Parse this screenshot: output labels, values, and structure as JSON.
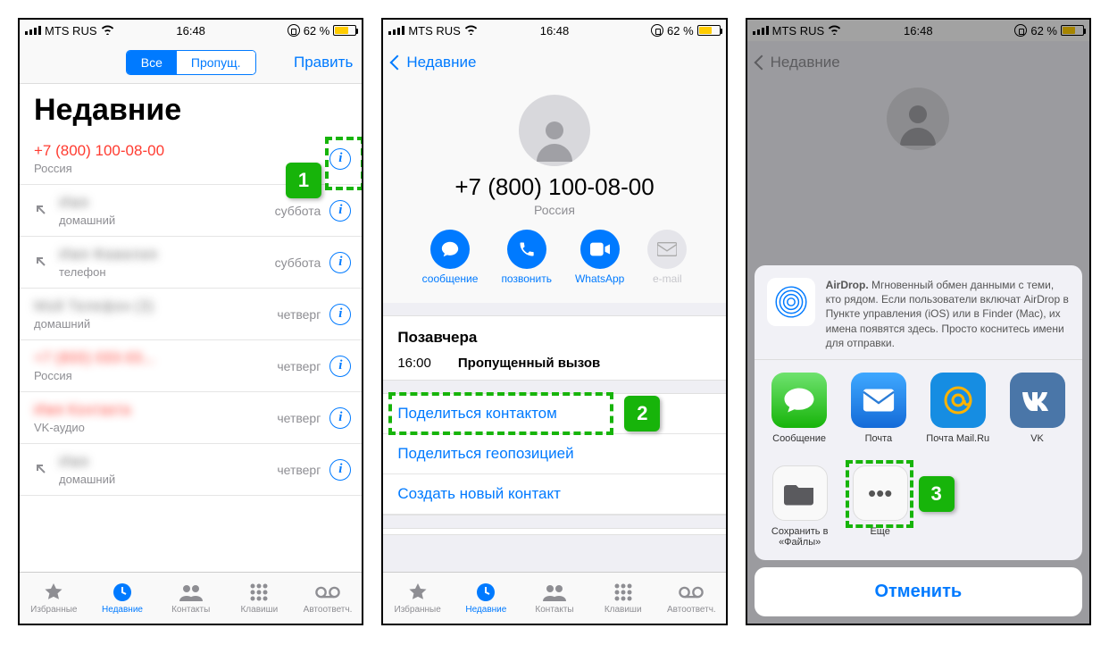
{
  "status": {
    "carrier": "MTS RUS",
    "time": "16:48",
    "battery": "62 %"
  },
  "screen1": {
    "seg_all": "Все",
    "seg_missed": "Пропущ.",
    "edit": "Править",
    "title": "Недавние",
    "rows": [
      {
        "name": "+7 (800) 100-08-00",
        "sub": "Россия",
        "date": "",
        "missed": true,
        "outgoing": false,
        "blur": false
      },
      {
        "name": "Имя",
        "sub": "домашний",
        "date": "суббота",
        "missed": false,
        "outgoing": true,
        "blur": true
      },
      {
        "name": "Имя Фамилия",
        "sub": "телефон",
        "date": "суббота",
        "missed": false,
        "outgoing": true,
        "blur": true
      },
      {
        "name": "Мой Телефон (3)",
        "sub": "домашний",
        "date": "четверг",
        "missed": false,
        "outgoing": false,
        "blur": true
      },
      {
        "name": "+7 (800) 000-00...",
        "sub": "Россия",
        "date": "четверг",
        "missed": true,
        "outgoing": false,
        "blur": true
      },
      {
        "name": "Имя Контакта",
        "sub": "VK-аудио",
        "date": "четверг",
        "missed": true,
        "outgoing": false,
        "blur": true
      },
      {
        "name": "Имя",
        "sub": "домашний",
        "date": "четверг",
        "missed": false,
        "outgoing": true,
        "blur": true
      }
    ],
    "tabs": {
      "fav": "Избранные",
      "recent": "Недавние",
      "contacts": "Контакты",
      "keypad": "Клавиши",
      "voicemail": "Автоответч."
    }
  },
  "screen2": {
    "back": "Недавние",
    "phone": "+7 (800) 100-08-00",
    "country": "Россия",
    "actions": {
      "message": "сообщение",
      "call": "позвонить",
      "whatsapp": "WhatsApp",
      "email": "e-mail"
    },
    "section": "Позавчера",
    "log_time": "16:00",
    "log_type": "Пропущенный вызов",
    "links": {
      "share": "Поделиться контактом",
      "geo": "Поделиться геопозицией",
      "create": "Создать новый контакт"
    }
  },
  "screen3": {
    "back": "Недавние",
    "airdrop_title": "AirDrop.",
    "airdrop_text": "Мгновенный обмен данными с теми, кто рядом. Если пользователи включат AirDrop в Пункте управления (iOS) или в Finder (Mac), их имена появятся здесь. Просто коснитесь имени для отправки.",
    "apps": {
      "message": "Сообщение",
      "mail": "Почта",
      "mailru": "Почта Mail.Ru",
      "vk": "VK"
    },
    "acts": {
      "files": "Сохранить в «Файлы»",
      "more": "Еще"
    },
    "cancel": "Отменить"
  },
  "callouts": {
    "c1": "1",
    "c2": "2",
    "c3": "3"
  }
}
